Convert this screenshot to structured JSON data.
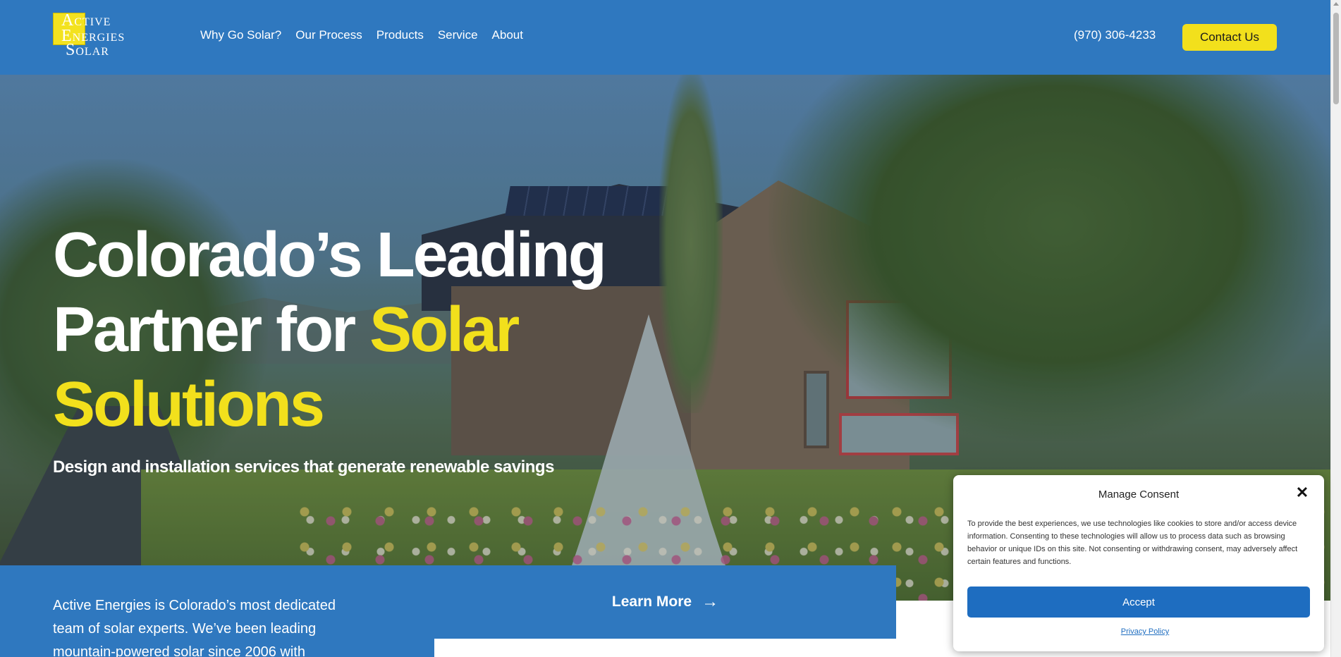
{
  "header": {
    "logo": {
      "line1_cap": "A",
      "line1_rest": "CTIVE",
      "line2_cap": "E",
      "line2_rest": "NERGIES",
      "line3_cap": "S",
      "line3_rest": "OLAR"
    },
    "nav": [
      {
        "label": "Why Go Solar?"
      },
      {
        "label": "Our Process"
      },
      {
        "label": "Products"
      },
      {
        "label": "Service"
      },
      {
        "label": "About"
      }
    ],
    "phone": "(970) 306-4233",
    "contact_label": "Contact Us"
  },
  "hero": {
    "headline_part1": "Colorado’s Leading Partner for ",
    "headline_highlight": "Solar Solutions",
    "subheadline": "Design and installation services that generate renewable savings"
  },
  "intro": {
    "text": "Active Energies is Colorado’s most dedicated team of solar experts. We’ve been leading mountain-powered solar since 2006 with",
    "learn_more_label": "Learn More",
    "learn_more_icon": "arrow-right-icon"
  },
  "consent": {
    "title": "Manage Consent",
    "body": "To provide the best experiences, we use technologies like cookies to store and/or access device information. Consenting to these technologies will allow us to process data such as browsing behavior or unique IDs on this site. Not consenting or withdrawing consent, may adversely affect certain features and functions.",
    "accept_label": "Accept",
    "privacy_label": "Privacy Policy",
    "close_icon": "close-icon"
  },
  "colors": {
    "brand_blue": "#2f78bf",
    "accent_yellow": "#f2e01c",
    "button_blue": "#1e6dc0"
  }
}
